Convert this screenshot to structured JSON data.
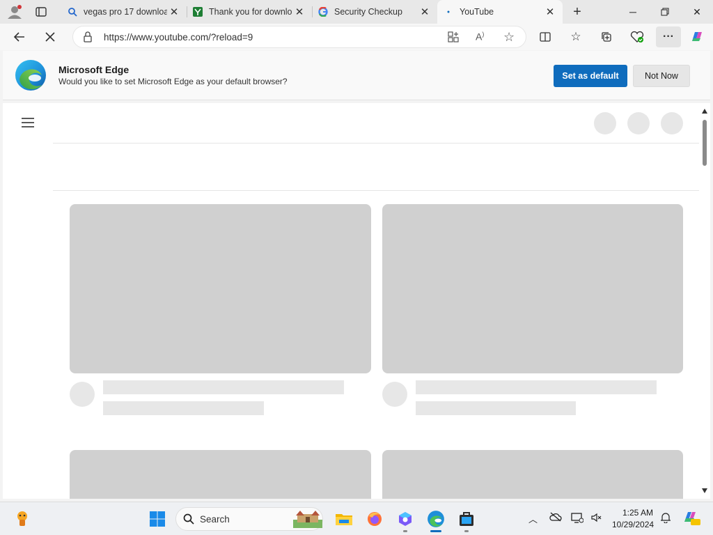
{
  "tabs": [
    {
      "title": "vegas pro 17 downloa",
      "icon": "search-icon"
    },
    {
      "title": "Thank you for downlo",
      "icon": "download-site-icon"
    },
    {
      "title": "Security Checkup",
      "icon": "google-icon"
    },
    {
      "title": "YouTube",
      "icon": "loading-icon"
    }
  ],
  "address_bar": {
    "url": "https://www.youtube.com/?reload=9"
  },
  "infobar": {
    "title": "Microsoft Edge",
    "message": "Would you like to set Microsoft Edge as your default browser?",
    "primary_label": "Set as default",
    "secondary_label": "Not Now"
  },
  "taskbar": {
    "search_placeholder": "Search",
    "time": "1:25 AM",
    "date": "10/29/2024"
  },
  "colors": {
    "accent": "#0f6cbd",
    "skeleton": "#d0d0d0",
    "skeleton_light": "#e7e7e7"
  }
}
